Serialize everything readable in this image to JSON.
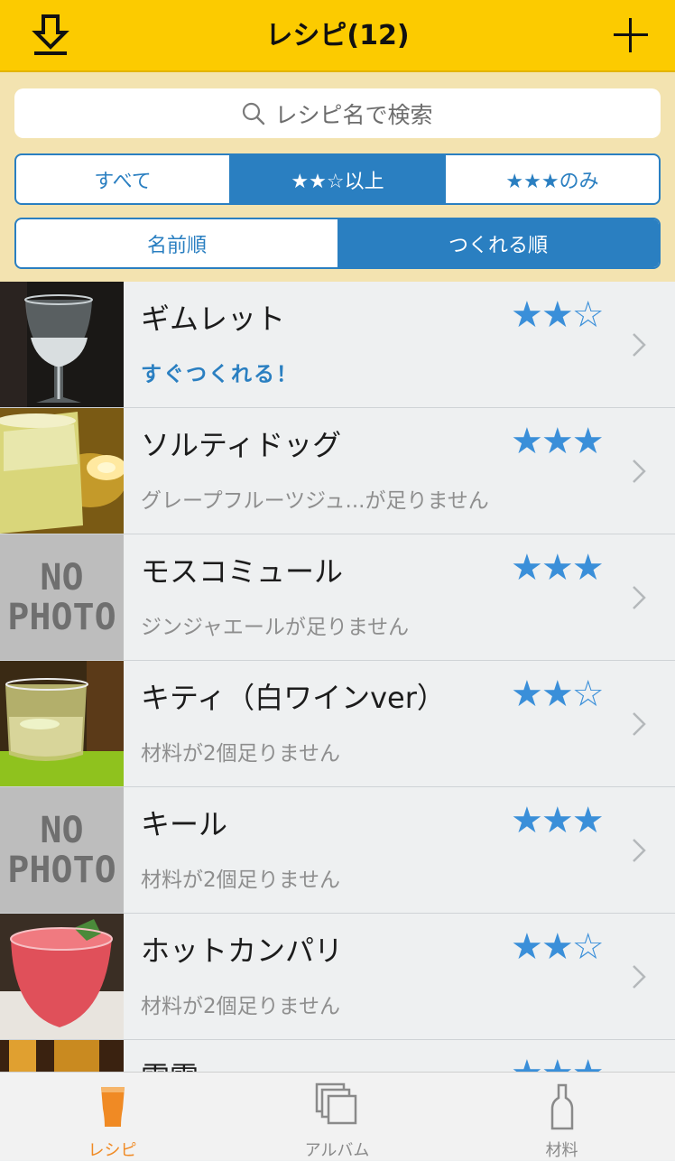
{
  "header": {
    "title": "レシピ(12)",
    "download_icon": "download-arrow-icon",
    "add_icon": "plus-icon"
  },
  "search": {
    "placeholder": "レシピ名で検索",
    "icon": "search-icon"
  },
  "rating_filter": {
    "options": [
      "すべて",
      "★★☆以上",
      "★★★のみ"
    ],
    "selected": "★★☆以上"
  },
  "sort_filter": {
    "options": [
      "名前順",
      "つくれる順"
    ],
    "selected": "つくれる順"
  },
  "recipes": [
    {
      "name": "ギムレット",
      "stars": "★★☆",
      "rating": 2,
      "status": "すぐつくれる！",
      "photo": "gimlet-photo"
    },
    {
      "name": "ソルティドッグ",
      "stars": "★★★",
      "rating": 3,
      "status": "グレープフルーツジュ...が足りません",
      "photo": "salty-dog-photo"
    },
    {
      "name": "モスコミュール",
      "stars": "★★★",
      "rating": 3,
      "status": "ジンジャエールが足りません",
      "photo": "NO PHOTO"
    },
    {
      "name": "キティ（白ワインver）",
      "stars": "★★☆",
      "rating": 2,
      "status": "材料が2個足りません",
      "photo": "kitty-photo"
    },
    {
      "name": "キール",
      "stars": "★★★",
      "rating": 3,
      "status": "材料が2個足りません",
      "photo": "NO PHOTO"
    },
    {
      "name": "ホットカンパリ",
      "stars": "★★☆",
      "rating": 2,
      "status": "材料が2個足りません",
      "photo": "hot-campari-photo"
    },
    {
      "name": "雷電",
      "stars": "★★★",
      "rating": 3,
      "status": "",
      "photo": "raiden-photo"
    }
  ],
  "nophoto_text": {
    "line1": "NO",
    "line2": "PHOTO"
  },
  "tabbar": {
    "tabs": [
      {
        "label": "レシピ",
        "icon": "beer-glass-icon",
        "active": true
      },
      {
        "label": "アルバム",
        "icon": "album-icon",
        "active": false
      },
      {
        "label": "材料",
        "icon": "bottle-icon",
        "active": false
      }
    ]
  },
  "colors": {
    "header_bg": "#fccb00",
    "filter_bg": "#f3e3b0",
    "accent_blue": "#2a7fc1",
    "star_blue": "#3a8fd9",
    "active_tab": "#f08a24"
  }
}
